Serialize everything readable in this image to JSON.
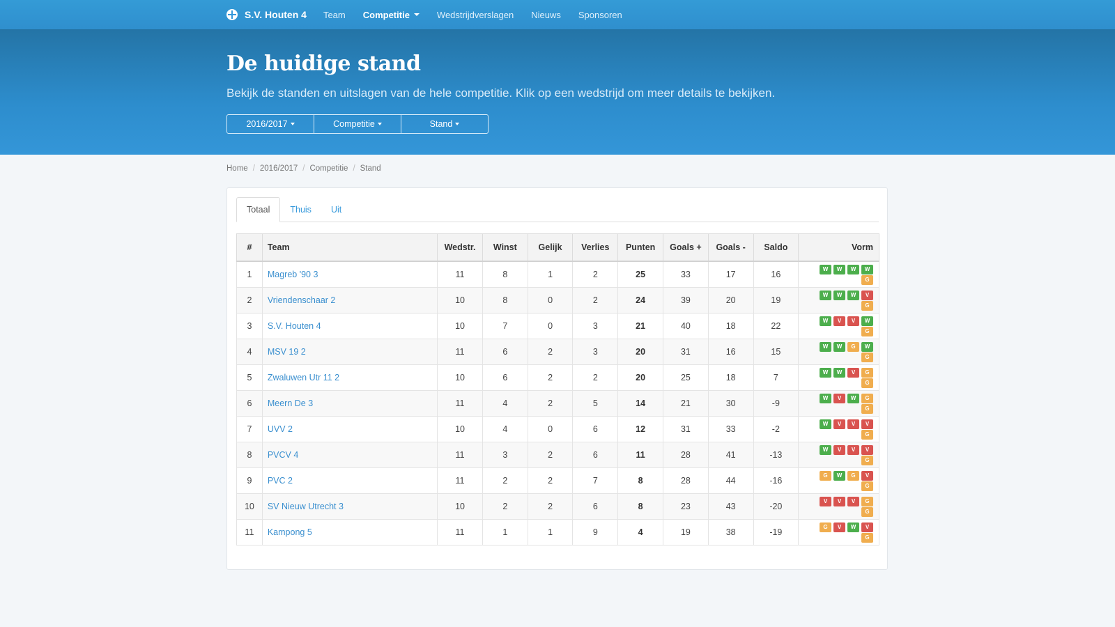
{
  "nav": {
    "brand": "S.V. Houten 4",
    "items": [
      {
        "label": "Team",
        "active": false,
        "dropdown": false
      },
      {
        "label": "Competitie",
        "active": true,
        "dropdown": true
      },
      {
        "label": "Wedstrijdverslagen",
        "active": false,
        "dropdown": false
      },
      {
        "label": "Nieuws",
        "active": false,
        "dropdown": false
      },
      {
        "label": "Sponsoren",
        "active": false,
        "dropdown": false
      }
    ]
  },
  "hero": {
    "title": "De huidige stand",
    "subtitle": "Bekijk de standen en uitslagen van de hele competitie. Klik op een wedstrijd om meer details te bekijken.",
    "buttons": [
      "2016/2017",
      "Competitie",
      "Stand"
    ]
  },
  "breadcrumb": [
    "Home",
    "2016/2017",
    "Competitie",
    "Stand"
  ],
  "tabs": [
    {
      "label": "Totaal",
      "active": true
    },
    {
      "label": "Thuis",
      "active": false
    },
    {
      "label": "Uit",
      "active": false
    }
  ],
  "table": {
    "headers": [
      "#",
      "Team",
      "Wedstr.",
      "Winst",
      "Gelijk",
      "Verlies",
      "Punten",
      "Goals +",
      "Goals -",
      "Saldo",
      "Vorm"
    ],
    "rows": [
      {
        "pos": "1",
        "team": "Magreb '90 3",
        "played": "11",
        "won": "8",
        "draw": "1",
        "lost": "2",
        "points": "25",
        "gf": "33",
        "ga": "17",
        "diff": "16",
        "form": [
          "W",
          "W",
          "W",
          "W",
          "G"
        ]
      },
      {
        "pos": "2",
        "team": "Vriendenschaar 2",
        "played": "10",
        "won": "8",
        "draw": "0",
        "lost": "2",
        "points": "24",
        "gf": "39",
        "ga": "20",
        "diff": "19",
        "form": [
          "W",
          "W",
          "W",
          "V",
          "G"
        ]
      },
      {
        "pos": "3",
        "team": "S.V. Houten 4",
        "played": "10",
        "won": "7",
        "draw": "0",
        "lost": "3",
        "points": "21",
        "gf": "40",
        "ga": "18",
        "diff": "22",
        "form": [
          "W",
          "V",
          "V",
          "W",
          "G"
        ]
      },
      {
        "pos": "4",
        "team": "MSV 19 2",
        "played": "11",
        "won": "6",
        "draw": "2",
        "lost": "3",
        "points": "20",
        "gf": "31",
        "ga": "16",
        "diff": "15",
        "form": [
          "W",
          "W",
          "G",
          "W",
          "G"
        ]
      },
      {
        "pos": "5",
        "team": "Zwaluwen Utr 11 2",
        "played": "10",
        "won": "6",
        "draw": "2",
        "lost": "2",
        "points": "20",
        "gf": "25",
        "ga": "18",
        "diff": "7",
        "form": [
          "W",
          "W",
          "V",
          "G",
          "G"
        ]
      },
      {
        "pos": "6",
        "team": "Meern De 3",
        "played": "11",
        "won": "4",
        "draw": "2",
        "lost": "5",
        "points": "14",
        "gf": "21",
        "ga": "30",
        "diff": "-9",
        "form": [
          "W",
          "V",
          "W",
          "G",
          "G"
        ]
      },
      {
        "pos": "7",
        "team": "UVV 2",
        "played": "10",
        "won": "4",
        "draw": "0",
        "lost": "6",
        "points": "12",
        "gf": "31",
        "ga": "33",
        "diff": "-2",
        "form": [
          "W",
          "V",
          "V",
          "V",
          "G"
        ]
      },
      {
        "pos": "8",
        "team": "PVCV 4",
        "played": "11",
        "won": "3",
        "draw": "2",
        "lost": "6",
        "points": "11",
        "gf": "28",
        "ga": "41",
        "diff": "-13",
        "form": [
          "W",
          "V",
          "V",
          "V",
          "G"
        ]
      },
      {
        "pos": "9",
        "team": "PVC 2",
        "played": "11",
        "won": "2",
        "draw": "2",
        "lost": "7",
        "points": "8",
        "gf": "28",
        "ga": "44",
        "diff": "-16",
        "form": [
          "G",
          "W",
          "G",
          "V",
          "G"
        ]
      },
      {
        "pos": "10",
        "team": "SV Nieuw Utrecht 3",
        "played": "10",
        "won": "2",
        "draw": "2",
        "lost": "6",
        "points": "8",
        "gf": "23",
        "ga": "43",
        "diff": "-20",
        "form": [
          "V",
          "V",
          "V",
          "G",
          "G"
        ]
      },
      {
        "pos": "11",
        "team": "Kampong 5",
        "played": "11",
        "won": "1",
        "draw": "1",
        "lost": "9",
        "points": "4",
        "gf": "19",
        "ga": "38",
        "diff": "-19",
        "form": [
          "G",
          "V",
          "W",
          "V",
          "G"
        ]
      }
    ]
  },
  "colors": {
    "primary": "#3498db",
    "win": "#4cae4c",
    "loss": "#d9534f",
    "draw": "#f0ad4e"
  },
  "icons": {
    "brand": "club-logo-icon",
    "dropdown": "caret-down-icon"
  }
}
